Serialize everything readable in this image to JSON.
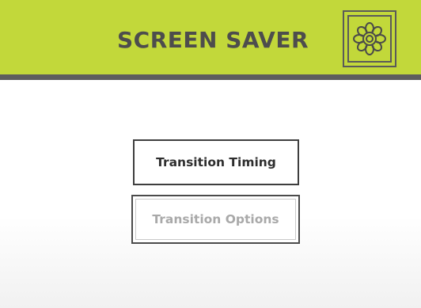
{
  "header": {
    "title": "SCREEN SAVER",
    "background_color": "#c2d83a",
    "rule_color": "#5d5d5d",
    "settings_button": {
      "icon": "flower-gear-icon"
    }
  },
  "main": {
    "buttons": [
      {
        "label": "Transition Timing",
        "state": "enabled"
      },
      {
        "label": "Transition Options",
        "state": "disabled"
      }
    ]
  }
}
